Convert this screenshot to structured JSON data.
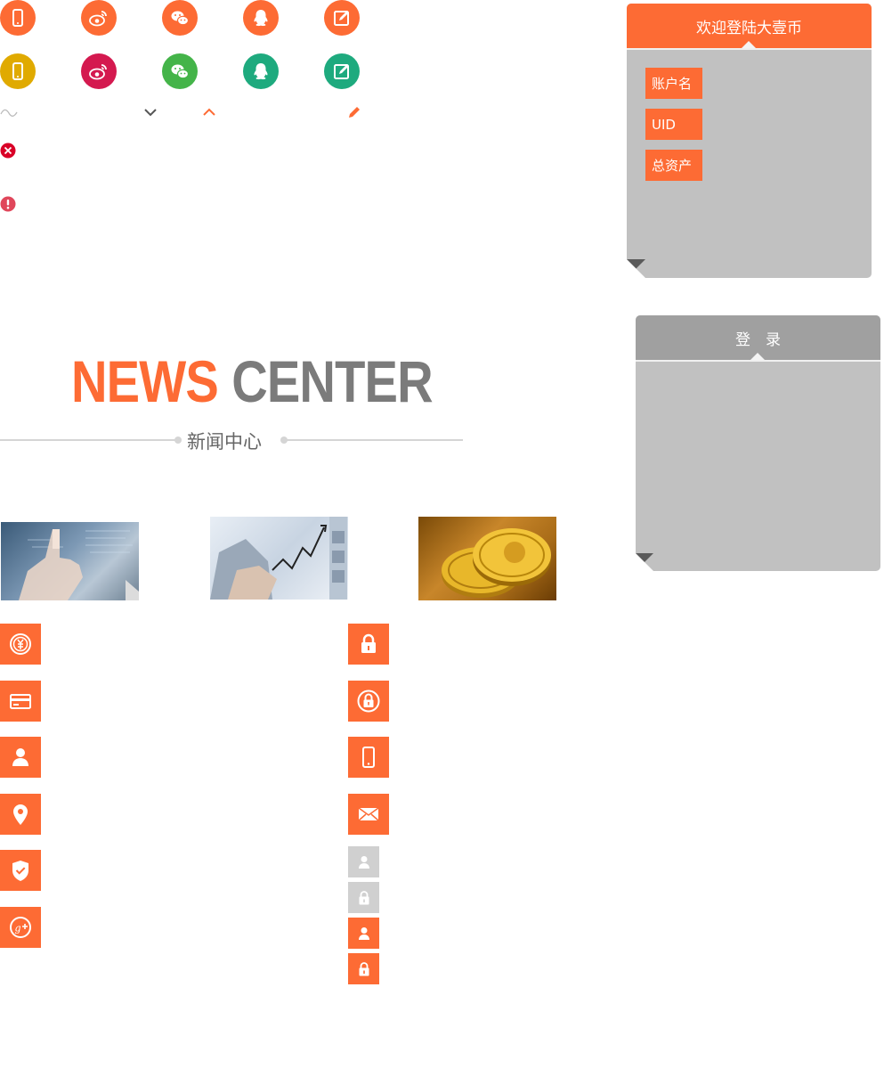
{
  "colors": {
    "accent": "#fd6b34",
    "panel_bg": "#c1c1c1",
    "panel_head_gray": "#a0a0a0",
    "yellow": "#e0aa00",
    "crimson": "#d4194f",
    "green": "#44b449",
    "teal": "#1eaa7e",
    "gray_title": "#7b7b7b",
    "error_red": "#d90027",
    "warn_red": "#e0475b"
  },
  "icons_row1": [
    "phone-icon",
    "weibo-icon",
    "wechat-icon",
    "qq-icon",
    "edit-icon"
  ],
  "icons_row2": [
    "phone-icon",
    "weibo-icon",
    "wechat-icon",
    "qq-icon",
    "edit-icon"
  ],
  "small_icons": [
    "tilde-icon",
    "chevron-down-icon",
    "chevron-up-icon",
    "pencil-icon",
    "error-icon",
    "alert-icon"
  ],
  "welcome_panel": {
    "title": "欢迎登陆大壹币",
    "fields": [
      "账户名",
      "UID",
      "总资产"
    ]
  },
  "login_panel": {
    "title": "登　录"
  },
  "news": {
    "title_part1": "NEWS",
    "title_part2": "CENTER",
    "subtitle": "新闻中心"
  },
  "news_images": [
    "touch-screen-image",
    "stock-chart-image",
    "gold-coins-image"
  ],
  "left_icons": [
    "yuan-icon",
    "card-icon",
    "user-icon",
    "location-icon",
    "shield-check-icon",
    "google-plus-icon"
  ],
  "right_icons": [
    "lock-icon",
    "lock-circle-icon",
    "phone-icon",
    "mail-icon"
  ],
  "mini_icons": [
    "user-icon",
    "lock-icon",
    "user-icon",
    "lock-icon"
  ]
}
